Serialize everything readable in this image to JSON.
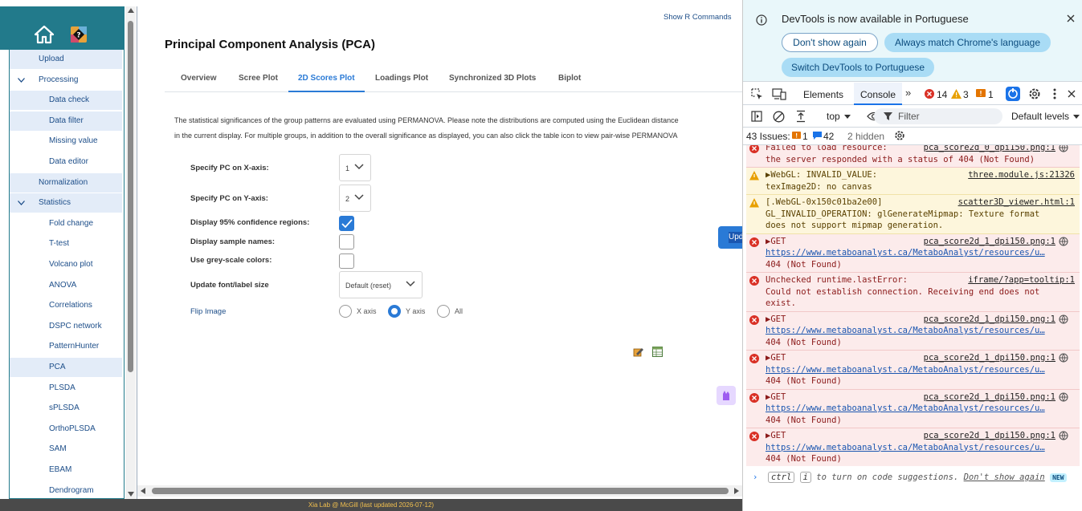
{
  "sidebar": {
    "items": [
      {
        "label": "Upload",
        "level": 1,
        "highlighted": true
      },
      {
        "label": "Processing",
        "level": 0,
        "expanded": true,
        "highlighted": false
      },
      {
        "label": "Data check",
        "level": 2,
        "highlighted": true
      },
      {
        "label": "Data filter",
        "level": 2,
        "highlighted": true
      },
      {
        "label": "Missing value",
        "level": 2,
        "highlighted": false
      },
      {
        "label": "Data editor",
        "level": 2,
        "highlighted": false
      },
      {
        "label": "Normalization",
        "level": 1,
        "highlighted": true
      },
      {
        "label": "Statistics",
        "level": 0,
        "expanded": true,
        "highlighted": true
      },
      {
        "label": "Fold change",
        "level": 2,
        "highlighted": false
      },
      {
        "label": "T-test",
        "level": 2,
        "highlighted": false
      },
      {
        "label": "Volcano plot",
        "level": 2,
        "highlighted": false
      },
      {
        "label": "ANOVA",
        "level": 2,
        "highlighted": false
      },
      {
        "label": "Correlations",
        "level": 2,
        "highlighted": false
      },
      {
        "label": "DSPC network",
        "level": 2,
        "highlighted": false
      },
      {
        "label": "PatternHunter",
        "level": 2,
        "highlighted": false
      },
      {
        "label": "PCA",
        "level": 2,
        "highlighted": true
      },
      {
        "label": "PLSDA",
        "level": 2,
        "highlighted": false
      },
      {
        "label": "sPLSDA",
        "level": 2,
        "highlighted": false
      },
      {
        "label": "OrthoPLSDA",
        "level": 2,
        "highlighted": false
      },
      {
        "label": "SAM",
        "level": 2,
        "highlighted": false
      },
      {
        "label": "EBAM",
        "level": 2,
        "highlighted": false
      },
      {
        "label": "Dendrogram",
        "level": 2,
        "highlighted": false
      }
    ]
  },
  "main": {
    "show_r": "Show R Commands",
    "title": "Principal Component Analysis (PCA)",
    "tabs": [
      {
        "label": "Overview",
        "active": false
      },
      {
        "label": "Scree Plot",
        "active": false
      },
      {
        "label": "2D Scores Plot",
        "active": true
      },
      {
        "label": "Loadings Plot",
        "active": false
      },
      {
        "label": "Synchronized 3D Plots",
        "active": false
      },
      {
        "label": "Biplot",
        "active": false
      }
    ],
    "description_line1": "The statistical significances of the group patterns are evaluated using PERMANOVA. Please note the distributions are computed using the Euclidean distance",
    "description_line2": "in the current display. For multiple groups, in addition to the overall significance as displayed, you can also click the table icon to view pair-wise PERMANOVA",
    "pc_x_label": "Specify PC on X-axis:",
    "pc_x_value": "1",
    "pc_y_label": "Specify PC on Y-axis:",
    "pc_y_value": "2",
    "conf_label": "Display 95% confidence regions:",
    "conf_checked": true,
    "names_label": "Display sample names:",
    "names_checked": false,
    "grey_label": "Use grey-scale colors:",
    "grey_checked": false,
    "font_label": "Update font/label size",
    "font_value": "Default (reset)",
    "flip_label": "Flip Image",
    "flip_options": [
      "X axis",
      "Y axis",
      "All"
    ],
    "flip_selected": "Y axis",
    "update_button": "Upd"
  },
  "footer": {
    "text": "Xia Lab @ McGill   (last updated 2026-07-12)"
  },
  "devtools": {
    "info_text": "DevTools is now available in Portuguese",
    "btn_dont_show": "Don't show again",
    "btn_always_match": "Always match Chrome's language",
    "btn_switch": "Switch DevTools to Portuguese",
    "tab_elements": "Elements",
    "tab_console": "Console",
    "errors_count": "14",
    "warnings_count": "3",
    "info_count": "1",
    "context": "top",
    "filter_placeholder": "Filter",
    "levels": "Default levels",
    "issues_label": "43 Issues:",
    "issues_errors": "1",
    "issues_info": "42",
    "hidden": "2 hidden",
    "messages": [
      {
        "type": "err",
        "lines": [
          "Failed to load resource:",
          "the server responded with a status of 404 (Not Found)"
        ],
        "source": "pca_score2d_0_dpi150.png:1"
      },
      {
        "type": "warn",
        "lines": [
          "▶WebGL: INVALID_VALUE:",
          "texImage2D: no canvas"
        ],
        "source": "three.module.js:21326"
      },
      {
        "type": "warn",
        "lines": [
          "[.WebGL-0x150c01ba2e00]",
          "GL_INVALID_OPERATION: glGenerateMipmap: Texture format",
          "does not support mipmap generation."
        ],
        "source": "scatter3D_viewer.html:1"
      },
      {
        "type": "err",
        "lines": [
          "▶GET",
          "https://www.metaboanalyst.ca/MetaboAnalyst/resources/u…",
          "404 (Not Found)"
        ],
        "source": "pca_score2d_1_dpi150.png:1"
      },
      {
        "type": "err",
        "lines": [
          "Unchecked runtime.lastError:",
          "Could not establish connection. Receiving end does not",
          "exist."
        ],
        "source": "iframe/?app=tooltip:1"
      },
      {
        "type": "err",
        "lines": [
          "▶GET",
          "https://www.metaboanalyst.ca/MetaboAnalyst/resources/u…",
          "404 (Not Found)"
        ],
        "source": "pca_score2d_1_dpi150.png:1"
      },
      {
        "type": "err",
        "lines": [
          "▶GET",
          "https://www.metaboanalyst.ca/MetaboAnalyst/resources/u…",
          "404 (Not Found)"
        ],
        "source": "pca_score2d_1_dpi150.png:1"
      },
      {
        "type": "err",
        "lines": [
          "▶GET",
          "https://www.metaboanalyst.ca/MetaboAnalyst/resources/u…",
          "404 (Not Found)"
        ],
        "source": "pca_score2d_1_dpi150.png:1"
      },
      {
        "type": "err",
        "lines": [
          "▶GET",
          "https://www.metaboanalyst.ca/MetaboAnalyst/resources/u…",
          "404 (Not Found)"
        ],
        "source": "pca_score2d_1_dpi150.png:1"
      }
    ],
    "prompt_key1": "ctrl",
    "prompt_key2": "i",
    "prompt_text": "to turn on code suggestions.",
    "prompt_link": "Don't show again",
    "prompt_badge": "NEW"
  }
}
